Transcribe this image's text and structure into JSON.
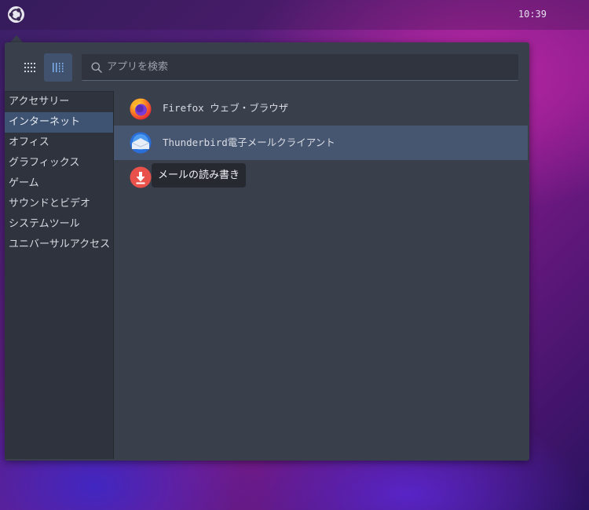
{
  "topbar": {
    "clock": "10:39"
  },
  "search": {
    "placeholder": "アプリを検索",
    "value": ""
  },
  "categories": [
    {
      "label": "アクセサリー"
    },
    {
      "label": "インターネット"
    },
    {
      "label": "オフィス"
    },
    {
      "label": "グラフィックス"
    },
    {
      "label": "ゲーム"
    },
    {
      "label": "サウンドとビデオ"
    },
    {
      "label": "システムツール"
    },
    {
      "label": "ユニバーサルアクセス"
    }
  ],
  "selected_category": "インターネット",
  "apps": [
    {
      "name": "Firefox ウェブ・ブラウザ",
      "icon": "firefox-icon"
    },
    {
      "name": "Thunderbird電子メールクライアント",
      "icon": "thunderbird-icon"
    },
    {
      "name": "",
      "icon": "download-icon"
    }
  ],
  "tooltip": {
    "text": "メールの読み書き"
  },
  "colors": {
    "panel": "#3a3f4c",
    "sidebar": "#2f333d",
    "selection": "#475670",
    "active_category": "#3e5272"
  }
}
